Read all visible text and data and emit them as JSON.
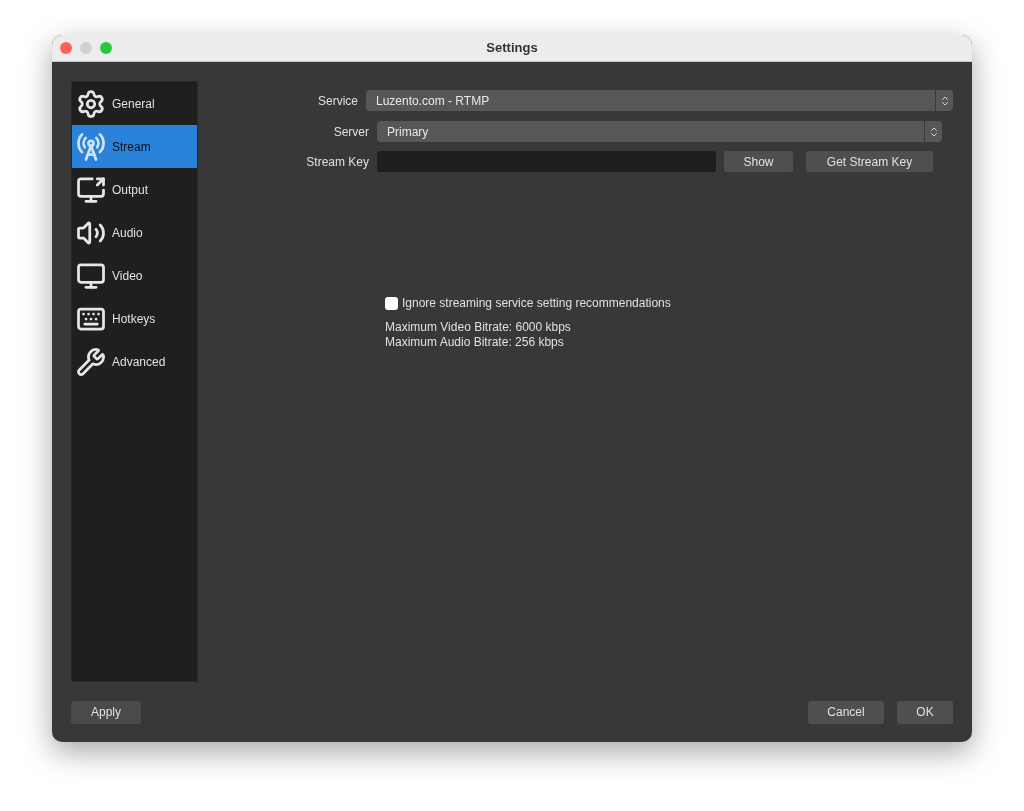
{
  "window": {
    "title": "Settings"
  },
  "sidebar": {
    "items": [
      {
        "label": "General",
        "selected": false
      },
      {
        "label": "Stream",
        "selected": true
      },
      {
        "label": "Output",
        "selected": false
      },
      {
        "label": "Audio",
        "selected": false
      },
      {
        "label": "Video",
        "selected": false
      },
      {
        "label": "Hotkeys",
        "selected": false
      },
      {
        "label": "Advanced",
        "selected": false
      }
    ]
  },
  "form": {
    "service": {
      "label": "Service",
      "value": "Luzento.com - RTMP"
    },
    "server": {
      "label": "Server",
      "value": "Primary"
    },
    "stream_key": {
      "label": "Stream Key"
    },
    "show_button": "Show",
    "get_key_button": "Get Stream Key",
    "ignore_checkbox": {
      "label": "Ignore streaming service setting recommendations",
      "checked": false
    },
    "info_lines": [
      "Maximum Video Bitrate: 6000 kbps",
      "Maximum Audio Bitrate: 256 kbps"
    ]
  },
  "buttons": {
    "apply": "Apply",
    "cancel": "Cancel",
    "ok": "OK"
  }
}
